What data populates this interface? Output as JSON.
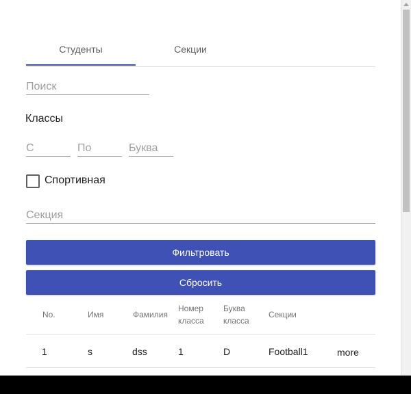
{
  "tabs": [
    {
      "label": "Студенты"
    },
    {
      "label": "Секции"
    }
  ],
  "filters": {
    "search_placeholder": "Поиск",
    "classes_heading": "Классы",
    "from_placeholder": "С",
    "to_placeholder": "По",
    "letter_placeholder": "Буква",
    "sport_label": "Спортивная",
    "section_placeholder": "Секция"
  },
  "buttons": {
    "filter_label": "Фильтровать",
    "reset_label": "Сбросить"
  },
  "colors": {
    "accent": "#3f51b5"
  },
  "table": {
    "headers": {
      "no": "No.",
      "name": "Имя",
      "surname": "Фамилия",
      "class_number_1": "Номер",
      "class_number_2": "класса",
      "class_letter_1": "Буква",
      "class_letter_2": "класса",
      "sections": "Секции"
    },
    "rows": [
      {
        "no": "1",
        "name": "s",
        "surname": "dss",
        "class_number": "1",
        "class_letter": "D",
        "sections": "Football1",
        "action": "more"
      }
    ]
  }
}
